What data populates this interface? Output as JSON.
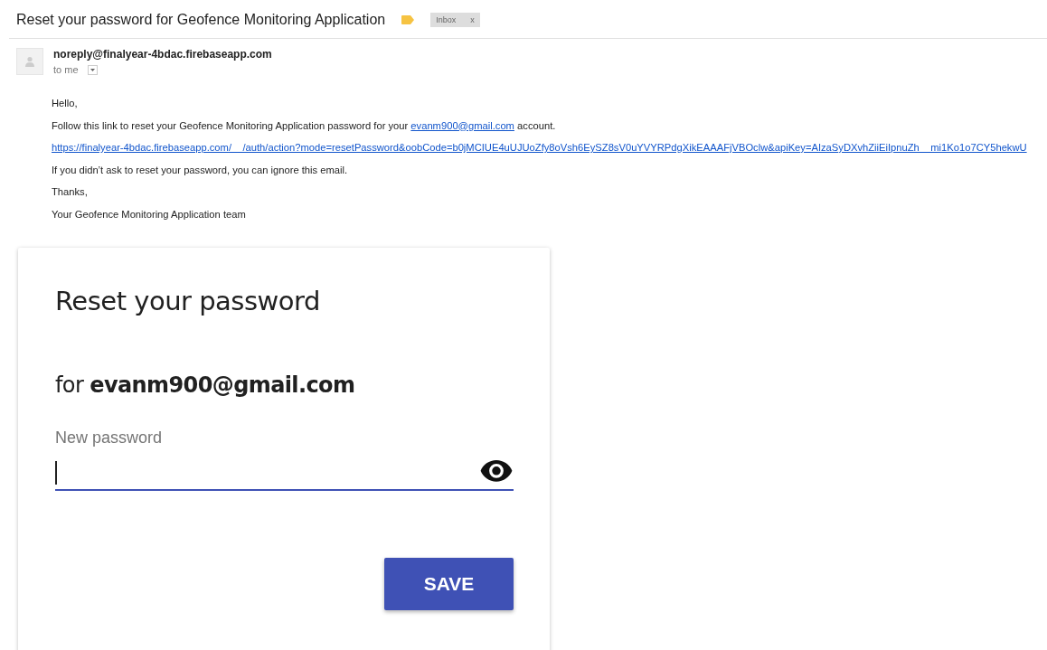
{
  "email": {
    "subject": "Reset your password for Geofence Monitoring Application",
    "label_tag": {
      "color": "#f6c342"
    },
    "folder_chip": {
      "label": "Inbox",
      "close": "x"
    },
    "sender": "noreply@finalyear-4bdac.firebaseapp.com",
    "recipient": "to me",
    "body": [
      {
        "kind": "text",
        "text": "Hello,"
      },
      {
        "kind": "mixed",
        "before": "Follow this link to reset your Geofence Monitoring Application password for your ",
        "link": "evanm900@gmail.com",
        "after": " account."
      },
      {
        "kind": "link",
        "text": "https://finalyear-4bdac.firebaseapp.com/__/auth/action?mode=resetPassword&oobCode=b0jMCIUE4uUJUoZfy8oVsh6EySZ8sV0uYVYRPdgXikEAAAFjVBOclw&apiKey=AIzaSyDXvhZiiEiIpnuZh__mi1Ko1o7CY5hekwU"
      },
      {
        "kind": "text",
        "text": "If you didn’t ask to reset your password, you can ignore this email."
      },
      {
        "kind": "text",
        "text": "Thanks,"
      },
      {
        "kind": "text",
        "text": "Your Geofence Monitoring Application team"
      }
    ]
  },
  "reset_card": {
    "title": "Reset your password",
    "for_prefix": "for",
    "account": "evanm900@gmail.com",
    "field": {
      "label": "New password",
      "focused": true
    },
    "button": "SAVE"
  }
}
